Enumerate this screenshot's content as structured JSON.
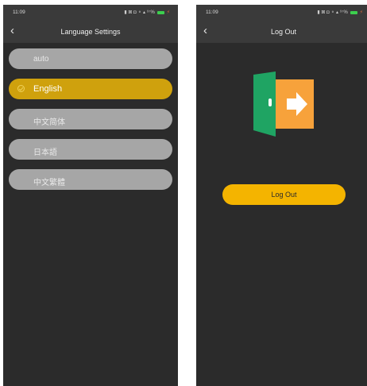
{
  "language_screen": {
    "status": {
      "time": "11:09",
      "indicators": "▮ ⊠ ◘ ⚬ ▴ ⁹⁷%"
    },
    "title": "Language Settings",
    "back_icon": "chevron-left-icon",
    "options": [
      {
        "label": "auto",
        "selected": false
      },
      {
        "label": "English",
        "selected": true
      },
      {
        "label": "中文简体",
        "selected": false
      },
      {
        "label": "日本語",
        "selected": false
      },
      {
        "label": "中文繁體",
        "selected": false
      }
    ]
  },
  "logout_screen": {
    "status": {
      "time": "11:09",
      "indicators": "▮ ⊠ ◘ ⚬ ▴ ⁹⁷%"
    },
    "title": "Log Out",
    "back_icon": "chevron-left-icon",
    "graphic_icon": "logout-door-icon",
    "button_label": "Log Out"
  },
  "colors": {
    "background": "#2b2b2b",
    "bar": "#3a3a3a",
    "option": "#a6a6a6",
    "selected": "#cfa10d",
    "button": "#f4b400",
    "door_green": "#1fa463",
    "door_orange": "#f7a23b"
  }
}
